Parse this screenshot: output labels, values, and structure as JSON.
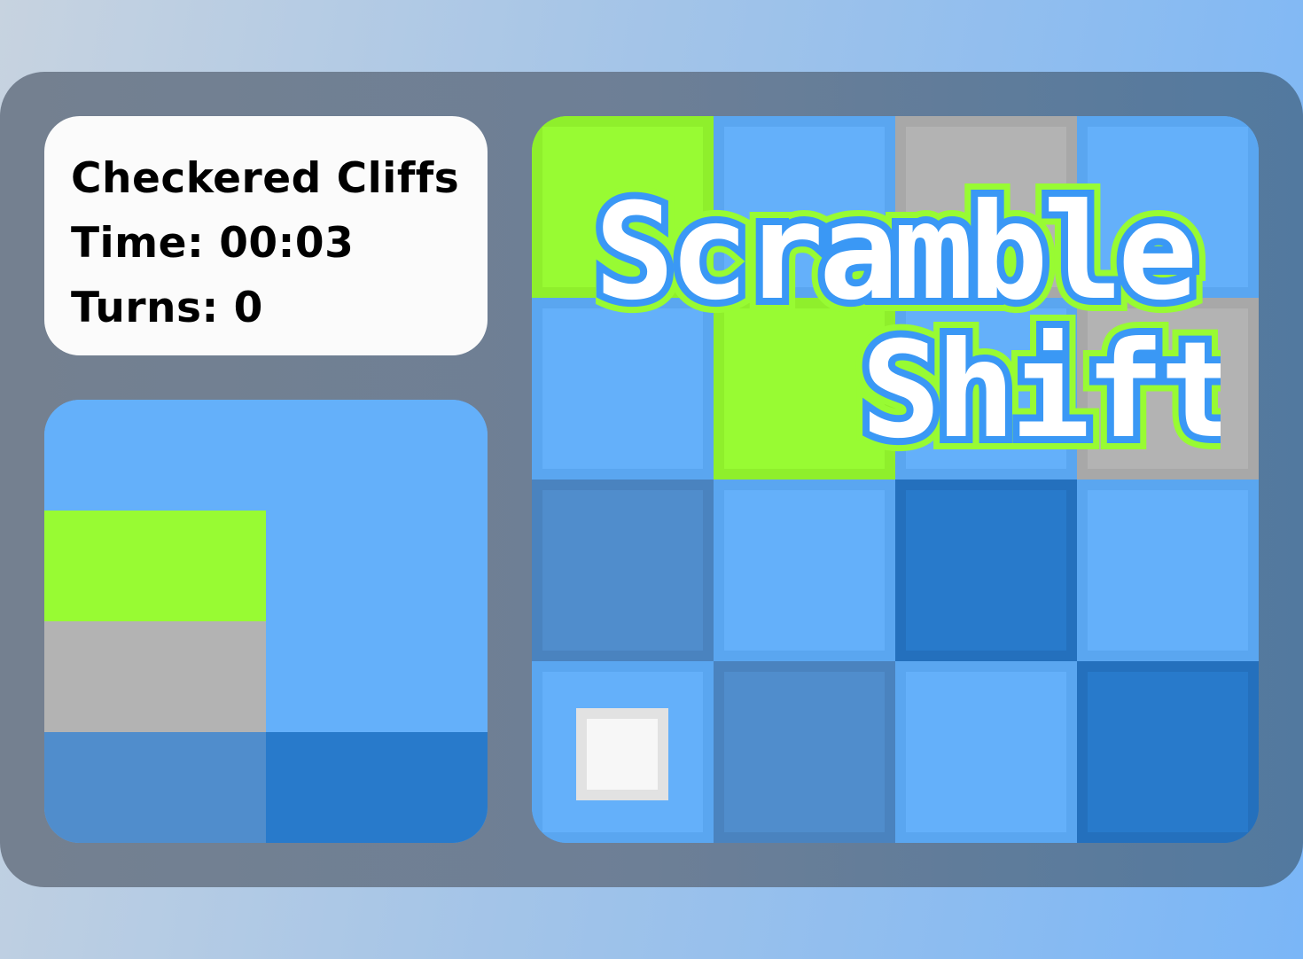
{
  "info": {
    "level_name": "Checkered Cliffs",
    "time_label": "Time:",
    "time_value": "00:03",
    "turns_label": "Turns:",
    "turns_value": "0"
  },
  "logo": {
    "line1": "Scramble",
    "line2": "Shift"
  },
  "colors": {
    "green": "#98fb33",
    "light_blue": "#64b0fa",
    "gray": "#b3b3b3",
    "mid_blue": "#508dcc",
    "dark_blue": "#287acb",
    "logo_fill": "#ffffff",
    "logo_outline": "#3a98f5",
    "logo_glow": "#98fb33"
  },
  "board": {
    "rows": 4,
    "cols": 4,
    "tiles": [
      [
        "green",
        "light",
        "gray",
        "light"
      ],
      [
        "light",
        "green",
        "light",
        "gray"
      ],
      [
        "mid",
        "light",
        "dark",
        "light"
      ],
      [
        "light",
        "mid",
        "light",
        "dark"
      ]
    ],
    "cursor": {
      "row": 3,
      "col": 0
    }
  },
  "preview": {
    "rows": 4,
    "cols": 2,
    "tiles": [
      [
        "light",
        "light"
      ],
      [
        "green",
        "light"
      ],
      [
        "gray",
        "light"
      ],
      [
        "mid",
        "dark"
      ]
    ]
  }
}
